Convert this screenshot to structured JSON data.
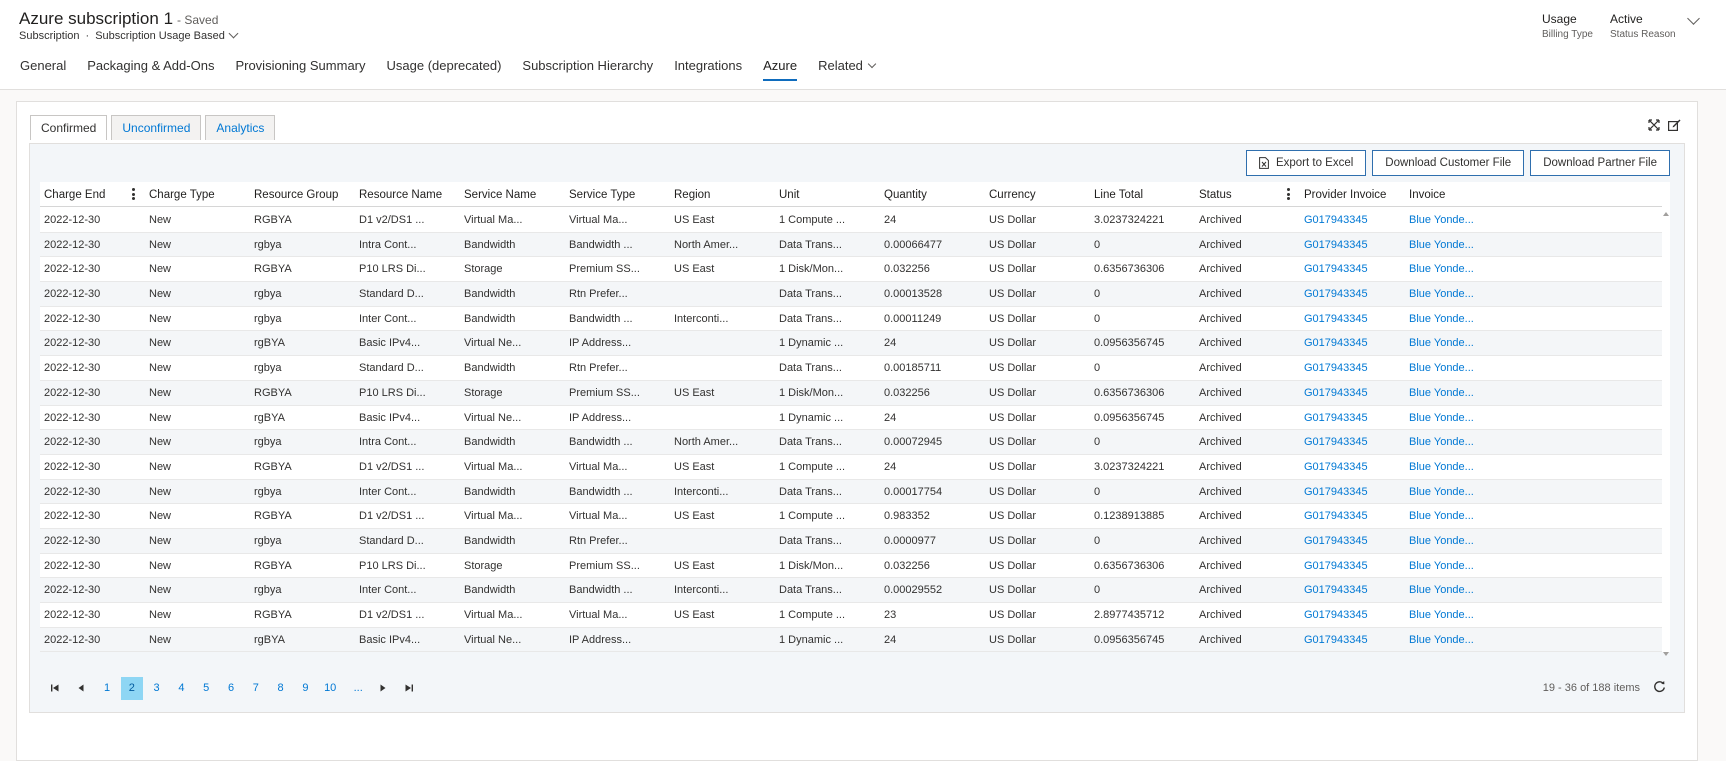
{
  "header": {
    "title": "Azure subscription 1",
    "saved": "- Saved",
    "entity": "Subscription",
    "separator": "·",
    "form_name": "Subscription Usage Based",
    "billing_type_value": "Usage",
    "billing_type_label": "Billing Type",
    "status_reason_value": "Active",
    "status_reason_label": "Status Reason"
  },
  "tabs": [
    "General",
    "Packaging & Add-Ons",
    "Provisioning Summary",
    "Usage (deprecated)",
    "Subscription Hierarchy",
    "Integrations",
    "Azure",
    "Related"
  ],
  "active_tab": "Azure",
  "subtabs": [
    "Confirmed",
    "Unconfirmed",
    "Analytics"
  ],
  "active_subtab": "Confirmed",
  "toolbar": {
    "export_excel": "Export to Excel",
    "download_customer": "Download Customer File",
    "download_partner": "Download Partner File"
  },
  "columns": [
    "Charge End",
    "Charge Type",
    "Resource Group",
    "Resource Name",
    "Service Name",
    "Service Type",
    "Region",
    "Unit",
    "Quantity",
    "Currency",
    "Line Total",
    "Status",
    "Provider Invoice",
    "Invoice"
  ],
  "rows": [
    [
      "2022-12-30",
      "New",
      "RGBYA",
      "D1 v2/DS1 ...",
      "Virtual Ma...",
      "Virtual Ma...",
      "US East",
      "1 Compute ...",
      "24",
      "US Dollar",
      "3.0237324221",
      "Archived",
      "G017943345",
      "Blue Yonde..."
    ],
    [
      "2022-12-30",
      "New",
      "rgbya",
      "Intra Cont...",
      "Bandwidth",
      "Bandwidth ...",
      "North Amer...",
      "Data Trans...",
      "0.00066477",
      "US Dollar",
      "0",
      "Archived",
      "G017943345",
      "Blue Yonde..."
    ],
    [
      "2022-12-30",
      "New",
      "RGBYA",
      "P10 LRS Di...",
      "Storage",
      "Premium SS...",
      "US East",
      "1 Disk/Mon...",
      "0.032256",
      "US Dollar",
      "0.6356736306",
      "Archived",
      "G017943345",
      "Blue Yonde..."
    ],
    [
      "2022-12-30",
      "New",
      "rgbya",
      "Standard D...",
      "Bandwidth",
      "Rtn Prefer...",
      "",
      "Data Trans...",
      "0.00013528",
      "US Dollar",
      "0",
      "Archived",
      "G017943345",
      "Blue Yonde..."
    ],
    [
      "2022-12-30",
      "New",
      "rgbya",
      "Inter Cont...",
      "Bandwidth",
      "Bandwidth ...",
      "Interconti...",
      "Data Trans...",
      "0.00011249",
      "US Dollar",
      "0",
      "Archived",
      "G017943345",
      "Blue Yonde..."
    ],
    [
      "2022-12-30",
      "New",
      "rgBYA",
      "Basic IPv4...",
      "Virtual Ne...",
      "IP Address...",
      "",
      "1 Dynamic ...",
      "24",
      "US Dollar",
      "0.0956356745",
      "Archived",
      "G017943345",
      "Blue Yonde..."
    ],
    [
      "2022-12-30",
      "New",
      "rgbya",
      "Standard D...",
      "Bandwidth",
      "Rtn Prefer...",
      "",
      "Data Trans...",
      "0.00185711",
      "US Dollar",
      "0",
      "Archived",
      "G017943345",
      "Blue Yonde..."
    ],
    [
      "2022-12-30",
      "New",
      "RGBYA",
      "P10 LRS Di...",
      "Storage",
      "Premium SS...",
      "US East",
      "1 Disk/Mon...",
      "0.032256",
      "US Dollar",
      "0.6356736306",
      "Archived",
      "G017943345",
      "Blue Yonde..."
    ],
    [
      "2022-12-30",
      "New",
      "rgBYA",
      "Basic IPv4...",
      "Virtual Ne...",
      "IP Address...",
      "",
      "1 Dynamic ...",
      "24",
      "US Dollar",
      "0.0956356745",
      "Archived",
      "G017943345",
      "Blue Yonde..."
    ],
    [
      "2022-12-30",
      "New",
      "rgbya",
      "Intra Cont...",
      "Bandwidth",
      "Bandwidth ...",
      "North Amer...",
      "Data Trans...",
      "0.00072945",
      "US Dollar",
      "0",
      "Archived",
      "G017943345",
      "Blue Yonde..."
    ],
    [
      "2022-12-30",
      "New",
      "RGBYA",
      "D1 v2/DS1 ...",
      "Virtual Ma...",
      "Virtual Ma...",
      "US East",
      "1 Compute ...",
      "24",
      "US Dollar",
      "3.0237324221",
      "Archived",
      "G017943345",
      "Blue Yonde..."
    ],
    [
      "2022-12-30",
      "New",
      "rgbya",
      "Inter Cont...",
      "Bandwidth",
      "Bandwidth ...",
      "Interconti...",
      "Data Trans...",
      "0.00017754",
      "US Dollar",
      "0",
      "Archived",
      "G017943345",
      "Blue Yonde..."
    ],
    [
      "2022-12-30",
      "New",
      "RGBYA",
      "D1 v2/DS1 ...",
      "Virtual Ma...",
      "Virtual Ma...",
      "US East",
      "1 Compute ...",
      "0.983352",
      "US Dollar",
      "0.1238913885",
      "Archived",
      "G017943345",
      "Blue Yonde..."
    ],
    [
      "2022-12-30",
      "New",
      "rgbya",
      "Standard D...",
      "Bandwidth",
      "Rtn Prefer...",
      "",
      "Data Trans...",
      "0.0000977",
      "US Dollar",
      "0",
      "Archived",
      "G017943345",
      "Blue Yonde..."
    ],
    [
      "2022-12-30",
      "New",
      "RGBYA",
      "P10 LRS Di...",
      "Storage",
      "Premium SS...",
      "US East",
      "1 Disk/Mon...",
      "0.032256",
      "US Dollar",
      "0.6356736306",
      "Archived",
      "G017943345",
      "Blue Yonde..."
    ],
    [
      "2022-12-30",
      "New",
      "rgbya",
      "Inter Cont...",
      "Bandwidth",
      "Bandwidth ...",
      "Interconti...",
      "Data Trans...",
      "0.00029552",
      "US Dollar",
      "0",
      "Archived",
      "G017943345",
      "Blue Yonde..."
    ],
    [
      "2022-12-30",
      "New",
      "RGBYA",
      "D1 v2/DS1 ...",
      "Virtual Ma...",
      "Virtual Ma...",
      "US East",
      "1 Compute ...",
      "23",
      "US Dollar",
      "2.8977435712",
      "Archived",
      "G017943345",
      "Blue Yonde..."
    ],
    [
      "2022-12-30",
      "New",
      "rgBYA",
      "Basic IPv4...",
      "Virtual Ne...",
      "IP Address...",
      "",
      "1 Dynamic ...",
      "24",
      "US Dollar",
      "0.0956356745",
      "Archived",
      "G017943345",
      "Blue Yonde..."
    ]
  ],
  "pager": {
    "pages": [
      "1",
      "2",
      "3",
      "4",
      "5",
      "6",
      "7",
      "8",
      "9",
      "10",
      "..."
    ],
    "current": "2",
    "count_text": "19 - 36 of 188 items"
  },
  "colors": {
    "accent": "#0f6cbd",
    "link": "#0078d4",
    "current_page": "#8ed6f4"
  }
}
